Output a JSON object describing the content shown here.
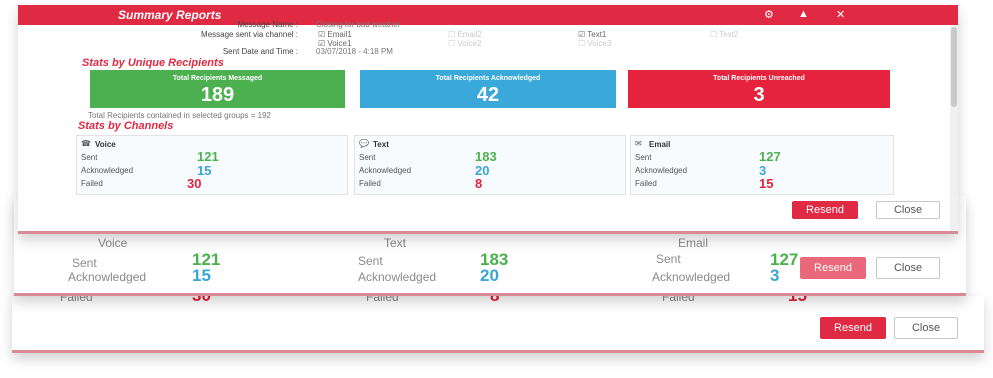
{
  "window": {
    "title": "Summary Reports"
  },
  "meta": {
    "message_name_label": "Message Name :",
    "message_name_value": "Closing for bad weather",
    "channel_label": "Message sent via channel :",
    "channels": [
      {
        "label": "Email1",
        "checked": true
      },
      {
        "label": "Email2",
        "checked": false
      },
      {
        "label": "Text1",
        "checked": true
      },
      {
        "label": "Text2",
        "checked": false
      },
      {
        "label": "Voice1",
        "checked": true
      },
      {
        "label": "Voice2",
        "checked": false
      },
      {
        "label": "Voice3",
        "checked": false
      }
    ],
    "sent_label": "Sent Date and Time :",
    "sent_value": "03/07/2018 - 4:18 PM"
  },
  "stats_unique": {
    "title": "Stats by Unique Recipients",
    "messaged": {
      "label": "Total Recipients Messaged",
      "value": "189",
      "color": "#4caf50"
    },
    "acknowledged": {
      "label": "Total Recipients Acknowledged",
      "value": "42",
      "color": "#3aa8d8"
    },
    "unreached": {
      "label": "Total Recipients Unreached",
      "value": "3",
      "color": "#e5233c"
    },
    "note": "Total Recipients contained in selected groups = 192"
  },
  "stats_channels": {
    "title": "Stats by Channels",
    "channels": [
      {
        "name": "Voice",
        "icon": "phone-icon",
        "sent": "121",
        "acknowledged": "15",
        "failed": "30"
      },
      {
        "name": "Text",
        "icon": "chat-icon",
        "sent": "183",
        "acknowledged": "20",
        "failed": "8"
      },
      {
        "name": "Email",
        "icon": "envelope-icon",
        "sent": "127",
        "acknowledged": "3",
        "failed": "15"
      }
    ],
    "sent_label": "Sent",
    "ack_label": "Acknowledged",
    "failed_label": "Failed"
  },
  "buttons": {
    "resend": "Resend",
    "close": "Close"
  },
  "colors": {
    "accent": "#e02a43",
    "green": "#4db04f",
    "blue": "#39a7d2",
    "red": "#e3233c"
  }
}
